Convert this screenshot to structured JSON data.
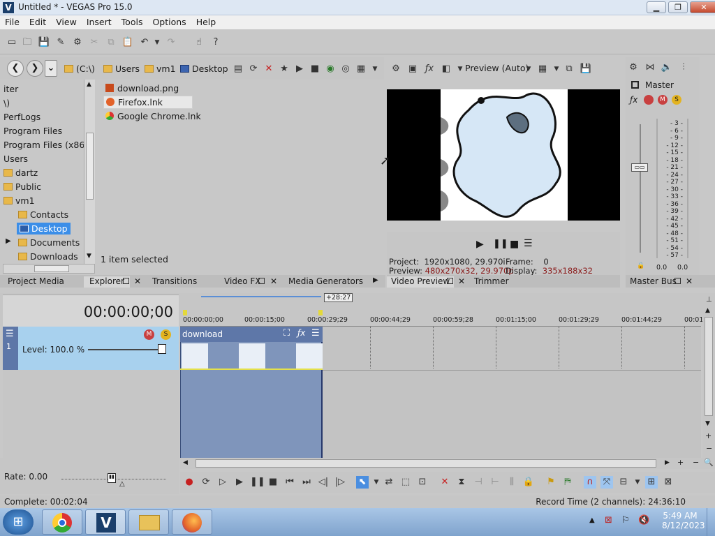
{
  "window": {
    "title": "Untitled * - VEGAS Pro 15.0",
    "logo": "V",
    "min": "▁",
    "max": "❐",
    "close": "✕"
  },
  "menu": [
    "File",
    "Edit",
    "View",
    "Insert",
    "Tools",
    "Options",
    "Help"
  ],
  "explorer": {
    "breadcrumbs": [
      "(C:\\)",
      "Users",
      "vm1",
      "Desktop"
    ],
    "tree": [
      {
        "label": "iter",
        "type": "text"
      },
      {
        "label": "\\)",
        "type": "text"
      },
      {
        "label": "PerfLogs",
        "type": "text"
      },
      {
        "label": "Program Files",
        "type": "text"
      },
      {
        "label": "Program Files (x86)",
        "type": "text"
      },
      {
        "label": "Users",
        "type": "text"
      },
      {
        "label": "dartz",
        "type": "folder"
      },
      {
        "label": "Public",
        "type": "folder"
      },
      {
        "label": "vm1",
        "type": "folder"
      },
      {
        "label": "Contacts",
        "type": "folder"
      },
      {
        "label": "Desktop",
        "type": "folder-selected"
      },
      {
        "label": "Documents",
        "type": "folder"
      },
      {
        "label": "Downloads",
        "type": "folder"
      }
    ],
    "files": [
      {
        "name": "download.png",
        "icon": "image-icon"
      },
      {
        "name": "Firefox.lnk",
        "icon": "firefox-icon"
      },
      {
        "name": "Google Chrome.lnk",
        "icon": "chrome-icon"
      }
    ],
    "status": "1 item selected"
  },
  "tabs_left": {
    "project_media": "Project Media",
    "explorer": "Explorer",
    "transitions": "Transitions",
    "video_fx": "Video FX",
    "media_generators": "Media Generators"
  },
  "preview": {
    "mode": "Preview (Auto)",
    "tab": "Video Preview",
    "trimmer": "Trimmer",
    "project_label": "Project:",
    "project_value": "1920x1080, 29.970i",
    "frame_label": "Frame:",
    "frame_value": "0",
    "preview_label": "Preview:",
    "preview_value": "480x270x32, 29.970p",
    "display_label": "Display:",
    "display_value": "335x188x32"
  },
  "master": {
    "label": "Master",
    "tab": "Master Bus",
    "scale": [
      "3",
      "6",
      "9",
      "12",
      "15",
      "18",
      "21",
      "24",
      "27",
      "30",
      "33",
      "36",
      "39",
      "42",
      "45",
      "48",
      "51",
      "54",
      "57"
    ],
    "left_level": "0.0",
    "right_level": "0.0"
  },
  "timeline": {
    "timecode": "00:00:00;00",
    "loop_marker": "+28:27",
    "ruler": [
      "00:00:00;00",
      "00:00:15;00",
      "00:00:29;29",
      "00:00:44;29",
      "00:00:59;28",
      "00:01:15;00",
      "00:01:29;29",
      "00:01:44;29",
      "00:01"
    ],
    "track_level_label": "Level:",
    "track_level_value": "100.0 %",
    "track_number": "1",
    "clip_name": "download",
    "rate_label": "Rate:",
    "rate_value": "0.00",
    "level_fraction": 1.0
  },
  "status": {
    "complete": "Complete: 00:02:04",
    "record": "Record Time (2 channels): 24:36:10"
  },
  "taskbar": {
    "time": "5:49 AM",
    "date": "8/12/2023"
  }
}
